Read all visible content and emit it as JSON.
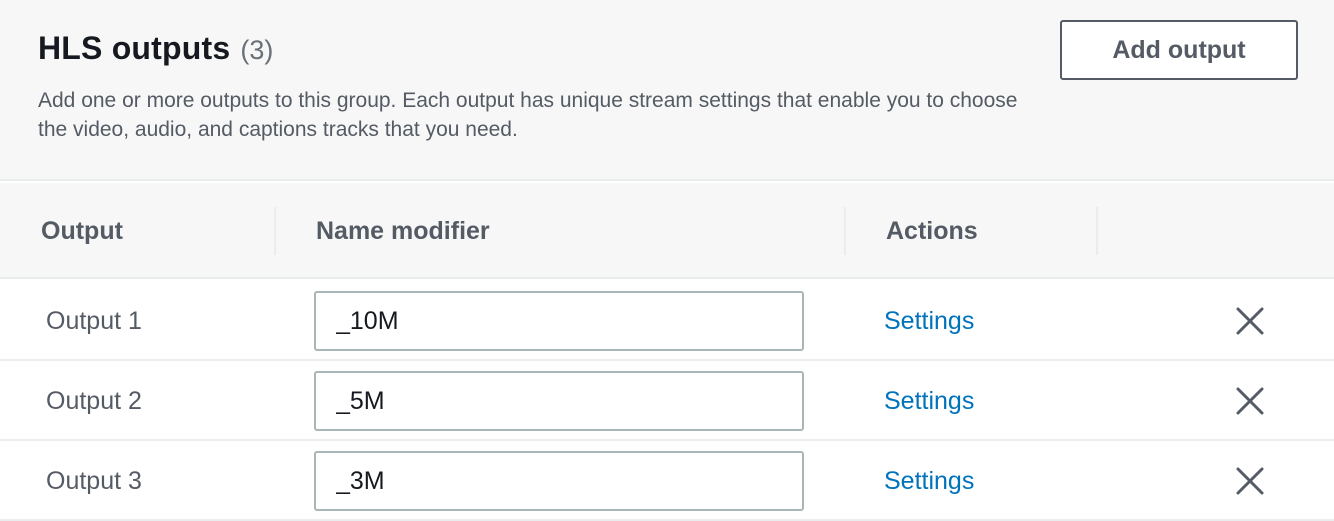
{
  "header": {
    "title": "HLS outputs",
    "count": "(3)",
    "description": "Add one or more outputs to this group. Each output has unique stream settings that enable you to choose the video, audio, and captions tracks that you need.",
    "add_button_label": "Add output"
  },
  "table": {
    "columns": {
      "output": "Output",
      "name_modifier": "Name modifier",
      "actions": "Actions"
    },
    "rows": [
      {
        "label": "Output 1",
        "name_modifier": "_10M",
        "action_label": "Settings",
        "remove_icon": "close-icon"
      },
      {
        "label": "Output 2",
        "name_modifier": "_5M",
        "action_label": "Settings",
        "remove_icon": "close-icon"
      },
      {
        "label": "Output 3",
        "name_modifier": "_3M",
        "action_label": "Settings",
        "remove_icon": "close-icon"
      }
    ]
  },
  "colors": {
    "link": "#0073bb",
    "header_bg": "#f7f7f7",
    "border": "#eaeded",
    "secondary_text": "#545b64"
  }
}
